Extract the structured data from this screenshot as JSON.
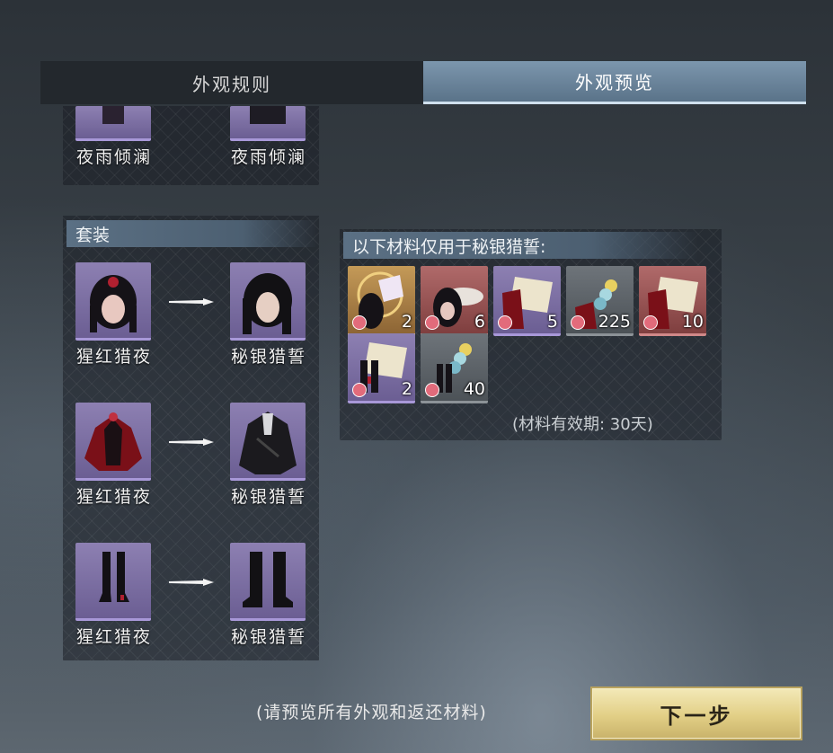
{
  "tabs": [
    {
      "label": "外观规则",
      "active": false
    },
    {
      "label": "外观预览",
      "active": true
    }
  ],
  "top_row": {
    "left_name": "夜雨倾澜",
    "right_name": "夜雨倾澜"
  },
  "set_section": {
    "title": "套装",
    "rows": [
      {
        "from_name": "猩红猎夜",
        "to_name": "秘银猎誓",
        "from_icon": "female-head-icon",
        "to_icon": "male-head-icon"
      },
      {
        "from_name": "猩红猎夜",
        "to_name": "秘银猎誓",
        "from_icon": "red-outfit-icon",
        "to_icon": "black-coat-icon"
      },
      {
        "from_name": "猩红猎夜",
        "to_name": "秘银猎誓",
        "from_icon": "heeled-boots-icon",
        "to_icon": "black-boots-icon"
      }
    ]
  },
  "materials": {
    "title": "以下材料仅用于秘银猎誓:",
    "items": [
      {
        "qty": "2",
        "rarity": "gold",
        "icon": "hair-ornament-icon"
      },
      {
        "qty": "6",
        "rarity": "red",
        "icon": "hairstyle-token-icon"
      },
      {
        "qty": "5",
        "rarity": "purple",
        "icon": "outfit-fabric-icon"
      },
      {
        "qty": "225",
        "rarity": "gray",
        "icon": "outfit-dye-icon"
      },
      {
        "qty": "10",
        "rarity": "red",
        "icon": "outfit-fabric-icon"
      },
      {
        "qty": "2",
        "rarity": "purple",
        "icon": "boots-fabric-icon"
      },
      {
        "qty": "40",
        "rarity": "gray",
        "icon": "boots-dye-icon"
      }
    ],
    "validity": "(材料有效期:  30天)"
  },
  "footer": {
    "notice": "(请预览所有外观和返还材料)",
    "next_label": "下一步"
  }
}
